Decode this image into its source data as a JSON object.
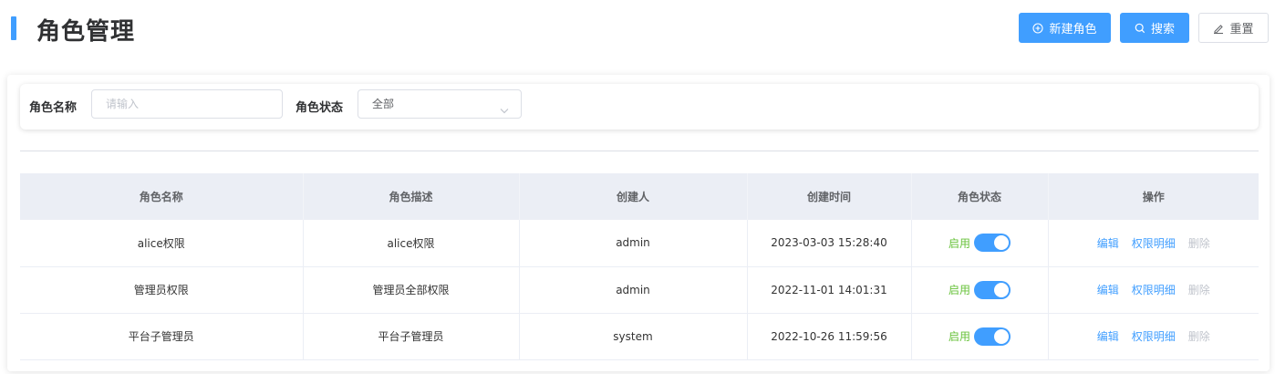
{
  "header": {
    "title": "角色管理",
    "new_label": "新建角色",
    "search_label": "搜索",
    "reset_label": "重置"
  },
  "filters": {
    "name_label": "角色名称",
    "name_placeholder": "请输入",
    "status_label": "角色状态",
    "status_value": "全部"
  },
  "table": {
    "columns": [
      "角色名称",
      "角色描述",
      "创建人",
      "创建时间",
      "角色状态",
      "操作"
    ],
    "rows": [
      {
        "name": "alice权限",
        "desc": "alice权限",
        "creator": "admin",
        "created": "2023-03-03 15:28:40",
        "status": "启用",
        "enabled": true
      },
      {
        "name": "管理员权限",
        "desc": "管理员全部权限",
        "creator": "admin",
        "created": "2022-11-01 14:01:31",
        "status": "启用",
        "enabled": true
      },
      {
        "name": "平台子管理员",
        "desc": "平台子管理员",
        "creator": "system",
        "created": "2022-10-26 11:59:56",
        "status": "启用",
        "enabled": true
      }
    ],
    "actions": {
      "edit": "编辑",
      "perm": "权限明细",
      "delete": "删除"
    }
  },
  "colors": {
    "primary": "#409eff",
    "success": "#67c23a",
    "disabled": "#c0c4cc"
  }
}
